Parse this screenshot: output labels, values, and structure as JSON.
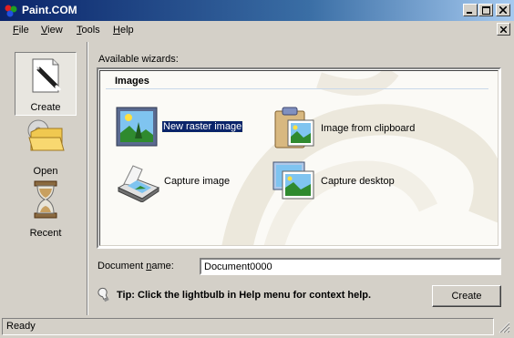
{
  "window": {
    "title": "Paint.COM",
    "controls": {
      "minimize": "minimize",
      "maximize": "maximize",
      "close": "close"
    }
  },
  "menu": {
    "items": [
      {
        "accel": "F",
        "rest": "ile"
      },
      {
        "accel": "V",
        "rest": "iew"
      },
      {
        "accel": "T",
        "rest": "ools"
      },
      {
        "accel": "H",
        "rest": "elp"
      }
    ]
  },
  "sidebar": {
    "items": [
      {
        "label": "Create",
        "icon": "create-pen-icon",
        "active": true
      },
      {
        "label": "Open",
        "icon": "open-folder-icon",
        "active": false
      },
      {
        "label": "Recent",
        "icon": "hourglass-icon",
        "active": false
      }
    ]
  },
  "wizards": {
    "available_label": "Available wizards:",
    "group_title": "Images",
    "items": [
      {
        "label": "New raster image",
        "icon": "new-raster-image-icon",
        "selected": true
      },
      {
        "label": "Image from clipboard",
        "icon": "clipboard-image-icon",
        "selected": false
      },
      {
        "label": "Capture image",
        "icon": "scanner-icon",
        "selected": false
      },
      {
        "label": "Capture desktop",
        "icon": "capture-desktop-icon",
        "selected": false
      }
    ]
  },
  "document": {
    "label_before": "Document ",
    "label_accel": "n",
    "label_after": "ame:",
    "value": "Document0000"
  },
  "tip": {
    "text": "Tip: Click the lightbulb in Help menu for context help."
  },
  "buttons": {
    "create": "Create"
  },
  "status": {
    "text": "Ready"
  },
  "colors": {
    "title_start": "#0a246a",
    "title_end": "#a6caf0",
    "face": "#d4d0c8",
    "selection": "#0a246a"
  }
}
